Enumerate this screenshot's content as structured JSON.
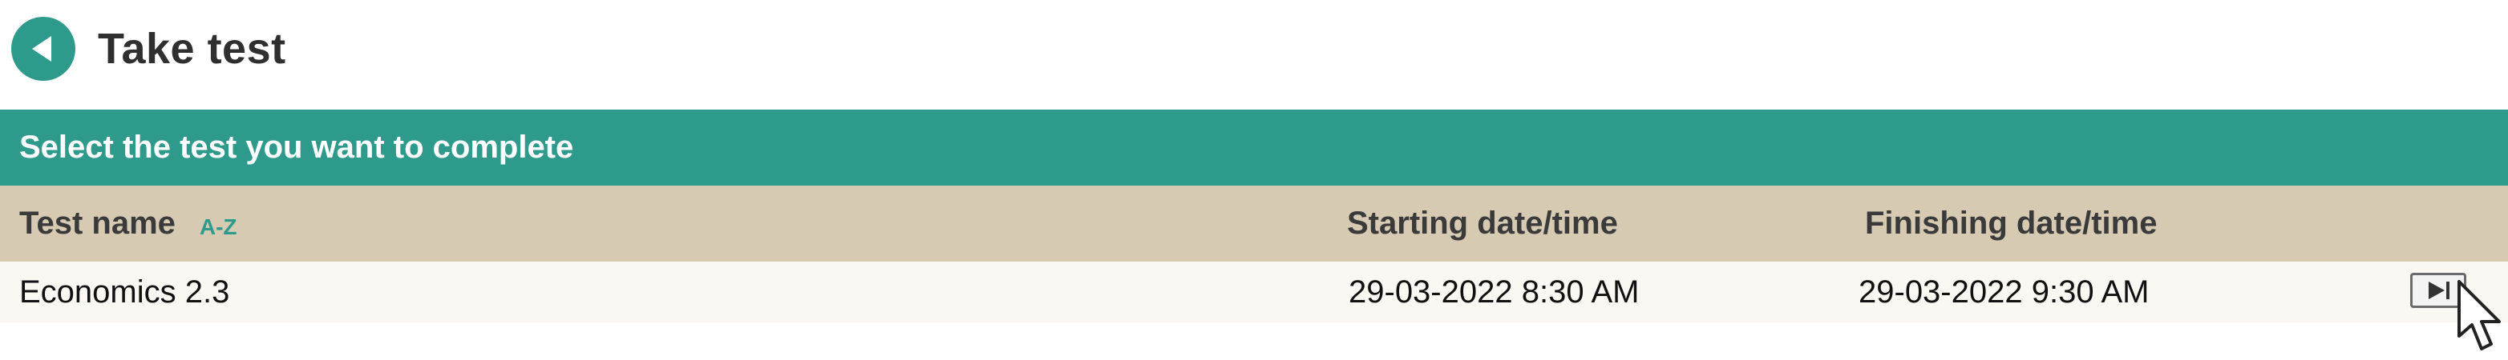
{
  "header": {
    "back_icon": "back-arrow-icon",
    "title": "Take test"
  },
  "table": {
    "instruction": "Select the test you want to complete",
    "columns": {
      "test_name": "Test name",
      "sort_label": "A-Z",
      "starting": "Starting date/time",
      "finishing": "Finishing date/time"
    },
    "rows": [
      {
        "test_name": "Economics 2.3",
        "starting": "29-03-2022 8:30 AM",
        "finishing": "29-03-2022 9:30 AM",
        "action_icon": "play-icon"
      }
    ]
  },
  "colors": {
    "accent": "#2e9a8c",
    "header_row": "#d6cab3",
    "data_row": "#faf8f2",
    "title_text": "#2f2f2f"
  }
}
